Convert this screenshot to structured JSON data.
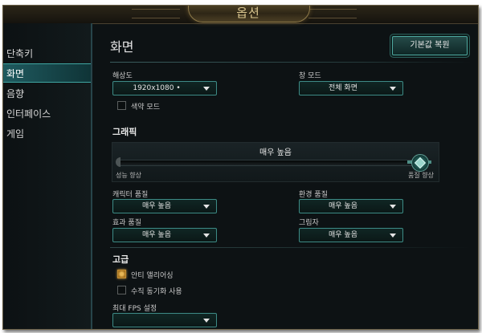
{
  "window": {
    "title": "옵션"
  },
  "sidebar": {
    "items": [
      {
        "label": "단축키",
        "active": false
      },
      {
        "label": "화면",
        "active": true
      },
      {
        "label": "음향",
        "active": false
      },
      {
        "label": "인터페이스",
        "active": false
      },
      {
        "label": "게임",
        "active": false
      }
    ]
  },
  "header": {
    "title": "화면",
    "reset_label": "기본값 복원"
  },
  "display": {
    "resolution_label": "해상도",
    "resolution_value": "1920x1080 •",
    "window_mode_label": "창 모드",
    "window_mode_value": "전체 화면",
    "colorblind_label": "색약 모드",
    "colorblind_checked": false
  },
  "graphics": {
    "section_title": "그래픽",
    "quality_value": "매우 높음",
    "quality_level": 1.0,
    "slider_min_label": "성능 향상",
    "slider_max_label": "품질 향상",
    "character_label": "캐릭터 품질",
    "character_value": "매우 높음",
    "environment_label": "환경 품질",
    "environment_value": "매우 높음",
    "effects_label": "효과 품질",
    "effects_value": "매우 높음",
    "shadows_label": "그림자",
    "shadows_value": "매우 높음"
  },
  "advanced": {
    "section_title": "고급",
    "antialias_label": "안티 앨리어싱",
    "antialias_checked": true,
    "vsync_label": "수직 동기화 사용",
    "vsync_checked": false,
    "fps_label": "최대 FPS 설정",
    "fps_value": ""
  },
  "colors": {
    "accent": "#3fa6a2",
    "gold": "#d9c58e",
    "background": "#0d1214"
  }
}
